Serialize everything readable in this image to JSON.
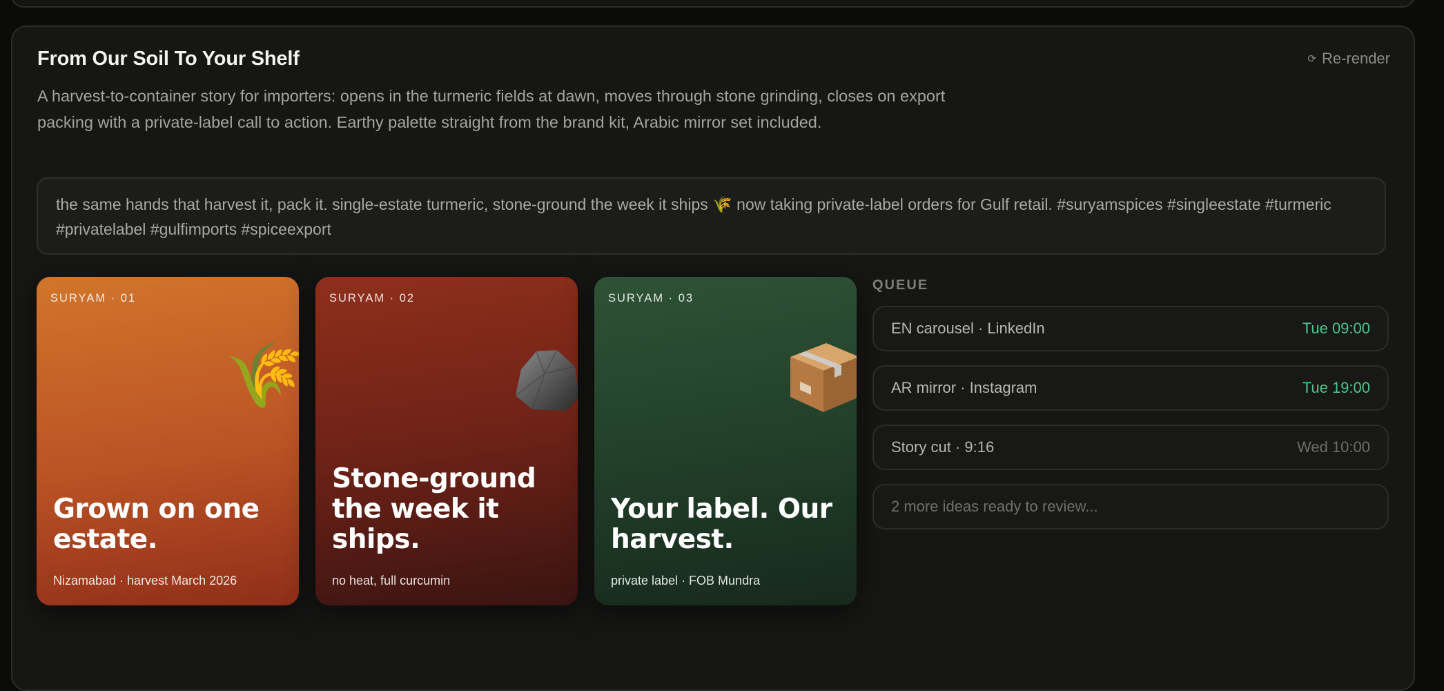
{
  "panel": {
    "title": "From Our Soil To Your Shelf",
    "rerender_label": "Re-render",
    "rerender_icon": "refresh-icon",
    "description": "A harvest-to-container story for importers: opens in the turmeric fields at dawn, moves through stone grinding, closes on export packing with a private-label call to action. Earthy palette straight from the brand kit, Arabic mirror set included.",
    "caption": "the same hands that harvest it, pack it. single-estate turmeric, stone-ground the week it ships 🌾 now taking private-label orders for Gulf retail. #suryamspices #singleestate #turmeric #privatelabel #gulfimports #spiceexport"
  },
  "slides": [
    {
      "brand": "SURYAM · 01",
      "headline": "Grown on one estate.",
      "footnote": "Nizamabad · harvest March 2026",
      "icon": "rice-sheaf-icon",
      "emoji": "🌾",
      "colors": [
        "#d1752b",
        "#8f2e19"
      ]
    },
    {
      "brand": "SURYAM · 02",
      "headline": "Stone-ground the week it ships.",
      "footnote": "no heat, full curcumin",
      "icon": "rock-icon",
      "emoji": "🪨",
      "colors": [
        "#8f2f1c",
        "#3a1411"
      ]
    },
    {
      "brand": "SURYAM · 03",
      "headline": "Your label. Our harvest.",
      "footnote": "private label · FOB Mundra",
      "icon": "package-box-icon",
      "emoji": "📦",
      "colors": [
        "#2f5235",
        "#17291c"
      ]
    }
  ],
  "queue": {
    "label": "QUEUE",
    "items": [
      {
        "label": "EN carousel · LinkedIn",
        "time": "Tue 09:00",
        "status_color": "#4cc58a"
      },
      {
        "label": "AR mirror · Instagram",
        "time": "Tue 19:00",
        "status_color": "#4cc58a"
      },
      {
        "label": "Story cut · 9:16",
        "time": "Wed 10:00",
        "status_color": "#6b6b67"
      }
    ],
    "more": "2 more ideas ready to review..."
  }
}
